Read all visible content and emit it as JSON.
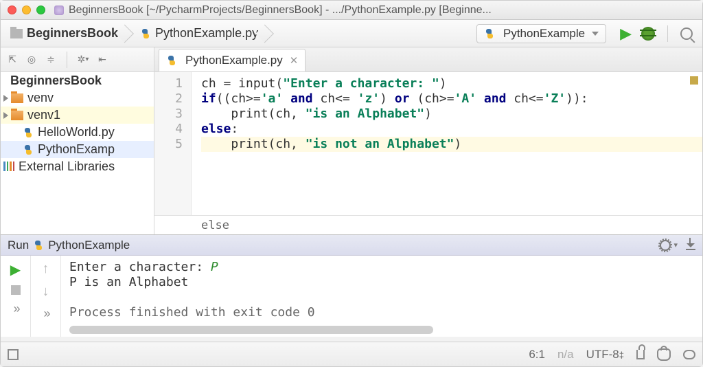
{
  "window": {
    "title": "BeginnersBook [~/PycharmProjects/BeginnersBook] - .../PythonExample.py [Beginne..."
  },
  "breadcrumb": {
    "project": "BeginnersBook",
    "file": "PythonExample.py"
  },
  "run_config": {
    "label": "PythonExample"
  },
  "project_tree": {
    "root": "BeginnersBook",
    "items": [
      {
        "name": "venv",
        "type": "folder"
      },
      {
        "name": "venv1",
        "type": "folder"
      },
      {
        "name": "HelloWorld.py",
        "type": "py"
      },
      {
        "name": "PythonExamp",
        "type": "py",
        "selected": true
      }
    ],
    "external": "External Libraries"
  },
  "editor": {
    "tab": "PythonExample.py",
    "line_numbers": [
      "1",
      "2",
      "3",
      "4",
      "5"
    ],
    "code": {
      "l1a": "ch = input(",
      "l1s": "\"Enter a character: \"",
      "l1b": ")",
      "l2a": "if",
      "l2b": "((ch>=",
      "l2s1": "'a'",
      "l2c": " ",
      "l2kw1": "and",
      "l2d": " ch<= ",
      "l2s2": "'z'",
      "l2e": ") ",
      "l2kw2": "or",
      "l2f": " (ch>=",
      "l2s3": "'A'",
      "l2g": " ",
      "l2kw3": "and",
      "l2h": " ch<=",
      "l2s4": "'Z'",
      "l2i": ")):",
      "l3a": "    print(ch, ",
      "l3s": "\"is an Alphabet\"",
      "l3b": ")",
      "l4": "else",
      "l4b": ":",
      "l5a": "    print(ch, ",
      "l5s": "\"is not an Alphabet\"",
      "l5b": ")"
    },
    "breadcrumb_bottom": "else"
  },
  "run_panel": {
    "title": "Run",
    "config": "PythonExample",
    "console": {
      "prompt": "Enter a character: ",
      "input": "P",
      "result": "P is an Alphabet",
      "exit": "Process finished with exit code 0"
    }
  },
  "status": {
    "pos": "6:1",
    "na": "n/a",
    "encoding": "UTF-8",
    "enc_suffix": "‡"
  }
}
